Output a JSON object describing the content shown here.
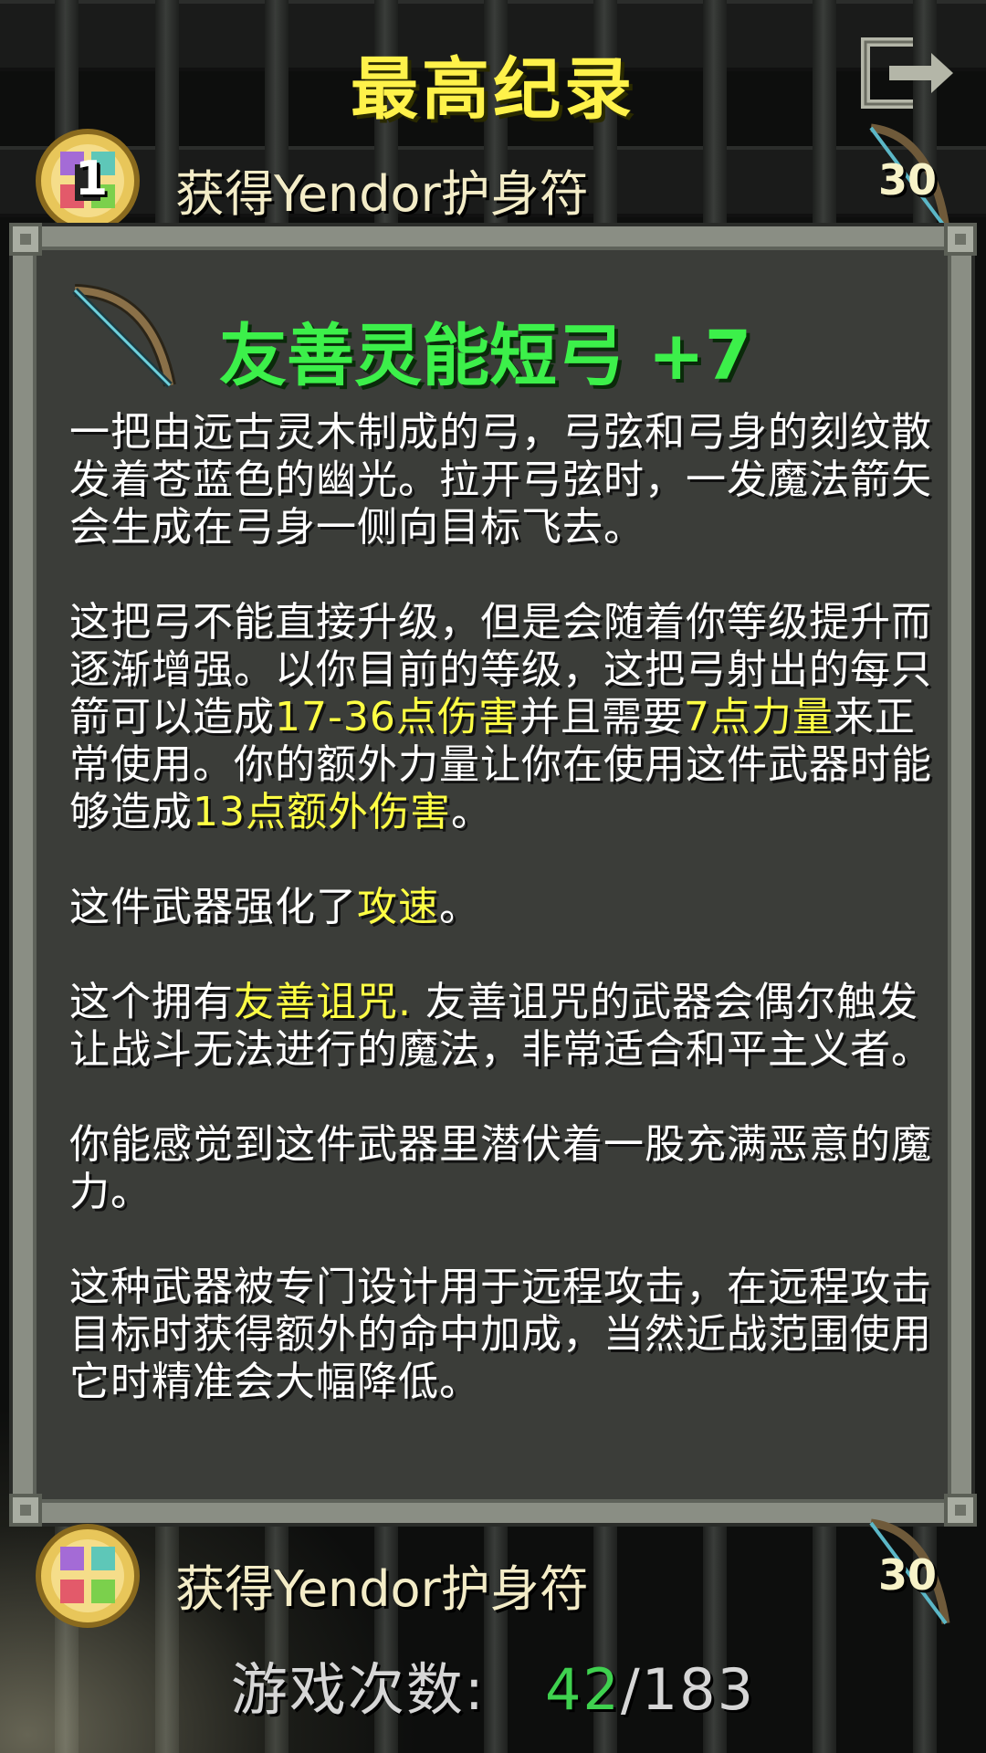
{
  "screen": {
    "title": "最高纪录"
  },
  "records": [
    {
      "label": "获得Yendor护身符",
      "rank": "1",
      "level": "30"
    },
    {
      "label": "获得Yendor护身符",
      "level": "30"
    }
  ],
  "item": {
    "name": "友善灵能短弓 +7",
    "paragraphs": [
      [
        {
          "text": "一把由远古灵木制成的弓，弓弦和弓身的刻纹散发着苍蓝色的幽光。拉开弓弦时，一发魔法箭矢会生成在弓身一侧向目标飞去。"
        }
      ],
      [
        {
          "text": "这把弓不能直接升级，但是会随着你等级提升而逐渐增强。以你目前的等级，这把弓射出的每只箭可以造成"
        },
        {
          "text": "17-36点伤害",
          "highlight": true
        },
        {
          "text": "并且需要"
        },
        {
          "text": "7点力量",
          "highlight": true
        },
        {
          "text": "来正常使用。你的额外力量让你在使用这件武器时能够造成"
        },
        {
          "text": "13点额外伤害",
          "highlight": true
        },
        {
          "text": "。"
        }
      ],
      [
        {
          "text": "这件武器强化了"
        },
        {
          "text": "攻速",
          "highlight": true
        },
        {
          "text": "。"
        }
      ],
      [
        {
          "text": "这个拥有"
        },
        {
          "text": "友善诅咒.",
          "highlight": true
        },
        {
          "text": " 友善诅咒的武器会偶尔触发让战斗无法进行的魔法，非常适合和平主义者。"
        }
      ],
      [
        {
          "text": "你能感觉到这件武器里潜伏着一股充满恶意的魔力。"
        }
      ],
      [
        {
          "text": "这种武器被专门设计用于远程攻击，在远程攻击目标时获得额外的命中加成，当然近战范围使用它时精准会大幅降低。"
        }
      ]
    ]
  },
  "games": {
    "label": "游戏次数:",
    "current": "42",
    "total": "/183"
  },
  "icons": {
    "exit": "exit-icon",
    "amulet": "amulet-of-yendor-icon",
    "bow": "spirit-bow-icon"
  },
  "colors": {
    "title": "#fff24a",
    "item_name": "#3cf04a",
    "highlight": "#ffff44",
    "games_current": "#3fd14f"
  }
}
